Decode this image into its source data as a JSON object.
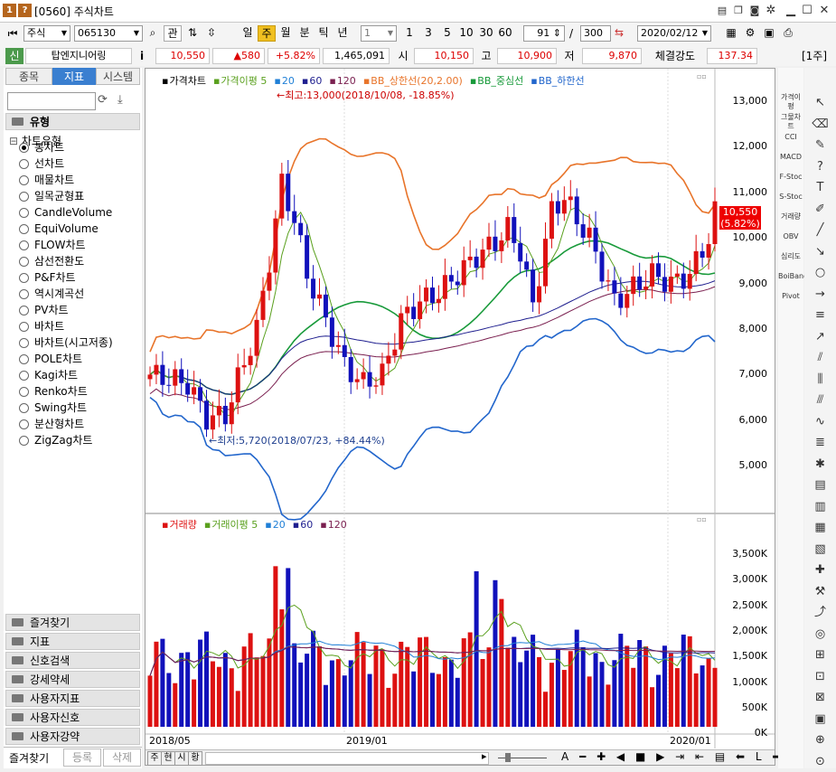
{
  "window": {
    "num": "1",
    "q": "?",
    "title": "[0560] 주식차트"
  },
  "toolbar": {
    "market": "주식",
    "code": "065130",
    "gwan": "관",
    "periods": [
      "일",
      "주",
      "월",
      "분",
      "틱",
      "년"
    ],
    "period_value": "1",
    "minutes": [
      "1",
      "3",
      "5",
      "10",
      "30",
      "60"
    ],
    "count": "91",
    "slash": "/",
    "total": "300",
    "date": "2020/02/12"
  },
  "quote": {
    "sin": "신",
    "name": "탑엔지니어링",
    "info": "i",
    "price": "10,550",
    "change": "▲580",
    "pct": "+5.82%",
    "volume": "1,465,091",
    "open_label": "시",
    "open": "10,150",
    "high_label": "고",
    "high": "10,900",
    "low_label": "저",
    "low": "9,870",
    "strength_label": "체결강도",
    "strength": "137.34",
    "unit": "[1주]"
  },
  "left": {
    "tabs": [
      "종목",
      "지표",
      "시스템"
    ],
    "section_top": "유형",
    "tree_root": "차트유형",
    "items": [
      "봉차트",
      "선차트",
      "매물차트",
      "일목균형표",
      "CandleVolume",
      "EquiVolume",
      "FLOW차트",
      "삼선전환도",
      "P&F차트",
      "역시계곡선",
      "PV차트",
      "바차트",
      "바차트(시고저종)",
      "POLE차트",
      "Kagi차트",
      "Renko차트",
      "Swing차트",
      "분산형차트",
      "ZigZag차트"
    ],
    "sections": [
      "즐겨찾기",
      "지표",
      "신호검색",
      "강세약세",
      "사용자지표",
      "사용자신호",
      "사용자강약"
    ],
    "bottom_tabs": [
      "즐겨찾기",
      "등록",
      "삭제"
    ]
  },
  "price_panel": {
    "legend": [
      {
        "label": "가격차트",
        "color": "#000000"
      },
      {
        "label": "가격이평 5",
        "color": "#5aa01e"
      },
      {
        "label": "20",
        "color": "#1f7fd6"
      },
      {
        "label": "60",
        "color": "#1f1f8f"
      },
      {
        "label": "120",
        "color": "#7a1f4f"
      },
      {
        "label": "BB_상한선(20,2.00)",
        "color": "#e8742a"
      },
      {
        "label": "BB_중심선",
        "color": "#189a3a"
      },
      {
        "label": "BB_하한선",
        "color": "#2266cc"
      }
    ],
    "high_annot": "←최고:13,000(2018/10/08, -18.85%)",
    "low_annot": "←최저:5,720(2018/07/23, +84.44%)",
    "current_price": "10,550",
    "current_pct": "(5.82%)",
    "y_ticks": [
      "13,000",
      "12,000",
      "11,000",
      "10,000",
      "9,000",
      "8,000",
      "7,000",
      "6,000",
      "5,000"
    ]
  },
  "volume_panel": {
    "legend": [
      {
        "label": "거래량",
        "color": "#dd1111"
      },
      {
        "label": "거래이평 5",
        "color": "#5aa01e"
      },
      {
        "label": "20",
        "color": "#1f7fd6"
      },
      {
        "label": "60",
        "color": "#1f1f8f"
      },
      {
        "label": "120",
        "color": "#7a1f4f"
      }
    ],
    "y_ticks": [
      "3,500K",
      "3,000K",
      "2,500K",
      "2,000K",
      "1,500K",
      "1,000K",
      "500K",
      "0K"
    ]
  },
  "x_labels": [
    "2018/05",
    "2019/01",
    "2020/01"
  ],
  "bottom_bar": {
    "tabs": [
      "주",
      "현",
      "시",
      "황"
    ]
  },
  "right_icons": [
    "가격이평",
    "그물차트",
    "CCI",
    "MACD",
    "F-Stoc",
    "S-Stoc",
    "거래량",
    "OBV",
    "심리도",
    "BoiBand",
    "Pivot"
  ],
  "colors": {
    "up": "#dd1111",
    "down": "#1111bb",
    "accent": "#f0c020"
  }
}
